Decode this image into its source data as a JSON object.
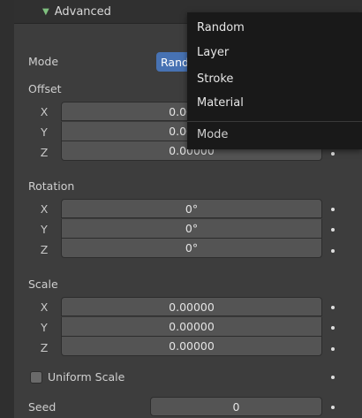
{
  "panel": {
    "title": "Advanced"
  },
  "mode": {
    "label": "Mode",
    "value": "Random"
  },
  "offset": {
    "label": "Offset",
    "rows": [
      {
        "axis": "X",
        "value": "0.00000"
      },
      {
        "axis": "Y",
        "value": "0.00000"
      },
      {
        "axis": "Z",
        "value": "0.00000"
      }
    ]
  },
  "rotation": {
    "label": "Rotation",
    "rows": [
      {
        "axis": "X",
        "value": "0°"
      },
      {
        "axis": "Y",
        "value": "0°"
      },
      {
        "axis": "Z",
        "value": "0°"
      }
    ]
  },
  "scale": {
    "label": "Scale",
    "rows": [
      {
        "axis": "X",
        "value": "0.00000"
      },
      {
        "axis": "Y",
        "value": "0.00000"
      },
      {
        "axis": "Z",
        "value": "0.00000"
      }
    ]
  },
  "uniform_scale": {
    "label": "Uniform Scale",
    "checked": false
  },
  "seed": {
    "label": "Seed",
    "value": "0"
  },
  "dropdown": {
    "items": [
      "Random",
      "Layer",
      "Stroke",
      "Material"
    ],
    "title": "Mode"
  }
}
